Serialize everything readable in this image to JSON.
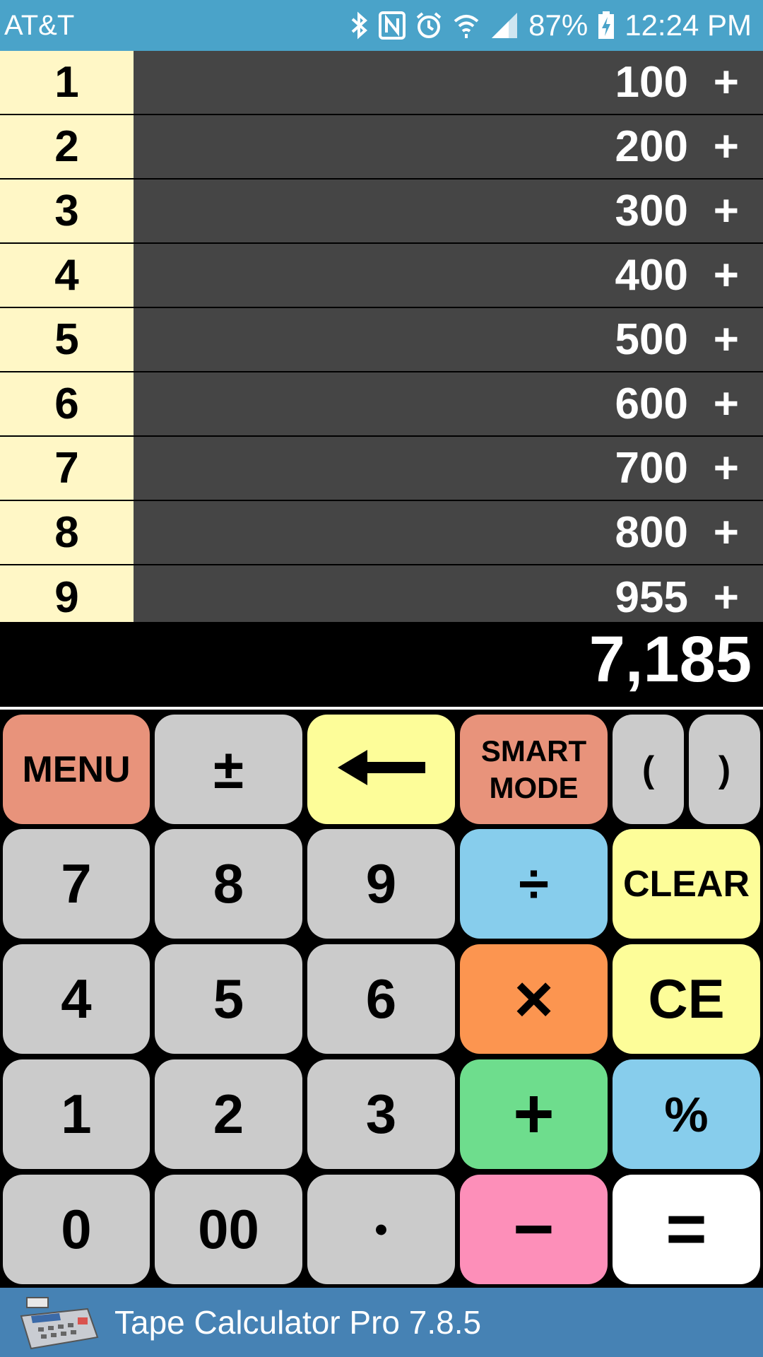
{
  "status_bar": {
    "carrier": "AT&T",
    "battery": "87%",
    "time": "12:24 PM",
    "icons": [
      "bluetooth-icon",
      "nfc-icon",
      "alarm-icon",
      "wifi-icon",
      "signal-icon",
      "battery-charging-icon"
    ]
  },
  "tape": {
    "rows": [
      {
        "index": "1",
        "value": "100",
        "op": "+"
      },
      {
        "index": "2",
        "value": "200",
        "op": "+"
      },
      {
        "index": "3",
        "value": "300",
        "op": "+"
      },
      {
        "index": "4",
        "value": "400",
        "op": "+"
      },
      {
        "index": "5",
        "value": "500",
        "op": "+"
      },
      {
        "index": "6",
        "value": "600",
        "op": "+"
      },
      {
        "index": "7",
        "value": "700",
        "op": "+"
      },
      {
        "index": "8",
        "value": "800",
        "op": "+"
      },
      {
        "index": "9",
        "value": "955",
        "op": "+"
      }
    ]
  },
  "display": {
    "total": "7,185"
  },
  "keypad": {
    "menu": "MENU",
    "plus_minus": "±",
    "backspace_icon": "left-arrow-icon",
    "smart_mode_line1": "SMART",
    "smart_mode_line2": "MODE",
    "paren_open": "(",
    "paren_close": ")",
    "seven": "7",
    "eight": "8",
    "nine": "9",
    "divide": "÷",
    "clear": "CLEAR",
    "four": "4",
    "five": "5",
    "six": "6",
    "multiply": "×",
    "ce": "CE",
    "one": "1",
    "two": "2",
    "three": "3",
    "add": "+",
    "percent": "%",
    "zero": "0",
    "double_zero": "00",
    "decimal": "•",
    "subtract": "−",
    "equals": "="
  },
  "footer": {
    "app_name": "Tape Calculator Pro  7.8.5",
    "icon": "calculator-icon"
  },
  "colors": {
    "status_bar": "#4aa3c9",
    "tape_index_bg": "#fff7c6",
    "tape_value_bg": "#454545",
    "footer": "#4682b4",
    "key_gray": "#cbcbcb",
    "key_salmon": "#e8937b",
    "key_yellow": "#fdfd99",
    "key_blue": "#87cdec",
    "key_orange": "#fc9550",
    "key_green": "#6edd8d",
    "key_pink": "#fd8fb9",
    "key_white": "#ffffff"
  }
}
